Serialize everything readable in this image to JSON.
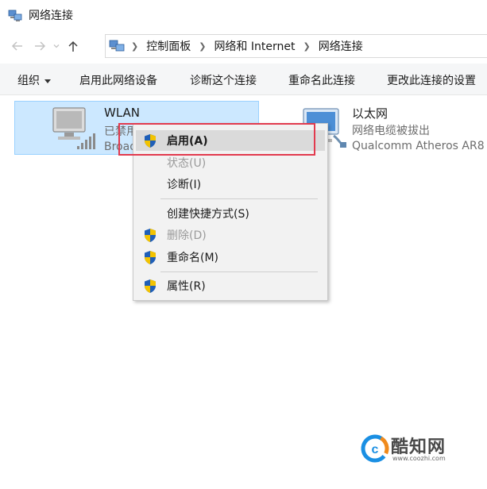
{
  "window": {
    "title": "网络连接",
    "title_icon": "network-connections-icon"
  },
  "address_bar": {
    "back_icon": "arrow-left-icon",
    "forward_icon": "arrow-right-icon",
    "history_icon": "chevron-down-icon",
    "up_icon": "arrow-up-icon",
    "location_icon": "control-panel-icon",
    "breadcrumbs": [
      "控制面板",
      "网络和 Internet",
      "网络连接"
    ]
  },
  "toolbar": {
    "organize": "组织",
    "enable_device": "启用此网络设备",
    "diagnose": "诊断这个连接",
    "rename": "重命名此连接",
    "change_settings": "更改此连接的设置"
  },
  "connections": [
    {
      "name": "WLAN",
      "status": "已禁用",
      "adapter": "Broadcom",
      "icon": "wireless-adapter-icon",
      "selected": true
    },
    {
      "name": "以太网",
      "status": "网络电缆被拔出",
      "adapter": "Qualcomm Atheros AR8",
      "icon": "ethernet-adapter-icon",
      "selected": false
    }
  ],
  "context_menu": {
    "items": [
      {
        "label": "启用(A)",
        "shield": true,
        "disabled": false,
        "default": true
      },
      {
        "label": "状态(U)",
        "shield": false,
        "disabled": true,
        "default": false
      },
      {
        "label": "诊断(I)",
        "shield": false,
        "disabled": false,
        "default": false
      },
      {
        "label": "创建快捷方式(S)",
        "shield": false,
        "disabled": false,
        "default": false
      },
      {
        "label": "删除(D)",
        "shield": true,
        "disabled": true,
        "default": false
      },
      {
        "label": "重命名(M)",
        "shield": true,
        "disabled": false,
        "default": false
      },
      {
        "label": "属性(R)",
        "shield": true,
        "disabled": false,
        "default": false
      }
    ],
    "shield_icon": "uac-shield-icon"
  },
  "annotation": {
    "highlight_color": "#e23a4e"
  },
  "watermark": {
    "brand": "酷知网",
    "url": "www.coozhi.com",
    "logo_icon": "coozhi-logo-icon"
  },
  "colors": {
    "selection_bg": "#cce8ff",
    "selection_border": "#99d1ff",
    "toolbar_bg": "#f5f6f7",
    "menu_bg": "#f2f2f2",
    "menu_hover": "#dadada",
    "disabled_text": "#9a9a9a"
  }
}
